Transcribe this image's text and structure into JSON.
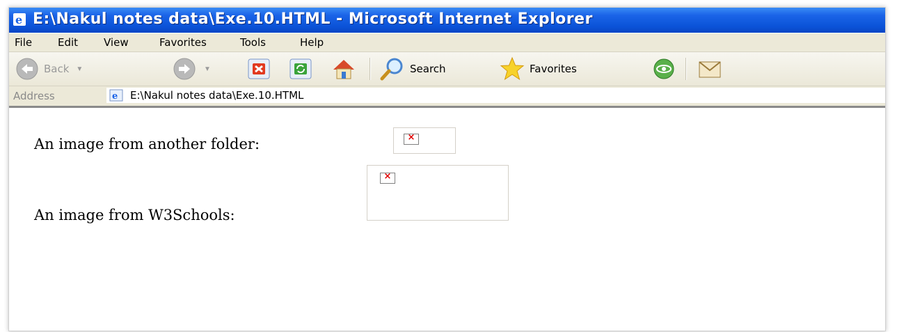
{
  "window": {
    "title": "E:\\Nakul notes data\\Exe.10.HTML - Microsoft Internet Explorer"
  },
  "menu": [
    "File",
    "Edit",
    "View",
    "Favorites",
    "Tools",
    "Help"
  ],
  "toolbar": {
    "back_label": "Back",
    "search_label": "Search",
    "favorites_label": "Favorites"
  },
  "address": {
    "label": "Address",
    "url": "E:\\Nakul notes data\\Exe.10.HTML"
  },
  "content": {
    "line1": "An image from another folder:",
    "line2": "An image from W3Schools:"
  },
  "colors": {
    "titlebar": "#0b53d8",
    "chrome": "#ece9d8",
    "broken_x": "#e00000"
  }
}
